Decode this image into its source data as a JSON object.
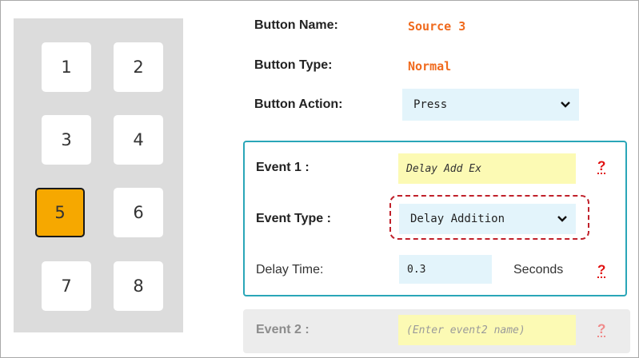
{
  "keypad": {
    "keys": [
      "1",
      "2",
      "3",
      "4",
      "5",
      "6",
      "7",
      "8"
    ],
    "selected": "5"
  },
  "button": {
    "name_label": "Button Name:",
    "name_value": "Source 3",
    "type_label": "Button Type:",
    "type_value": "Normal",
    "action_label": "Button Action:",
    "action_value": "Press"
  },
  "event1": {
    "name_label": "Event 1 :",
    "name_value": "Delay Add Ex",
    "help": "?",
    "type_label": "Event Type :",
    "type_value": "Delay Addition",
    "delay_label": "Delay Time:",
    "delay_value": "0.3",
    "delay_unit": "Seconds",
    "delay_help": "?"
  },
  "event2": {
    "name_label": "Event 2 :",
    "name_placeholder": "(Enter event2 name)",
    "help": "?"
  },
  "colors": {
    "accent_orange": "#f06a1d",
    "selected_key": "#f6a800",
    "event_border": "#2aa6b8",
    "help_red": "#e01010"
  }
}
